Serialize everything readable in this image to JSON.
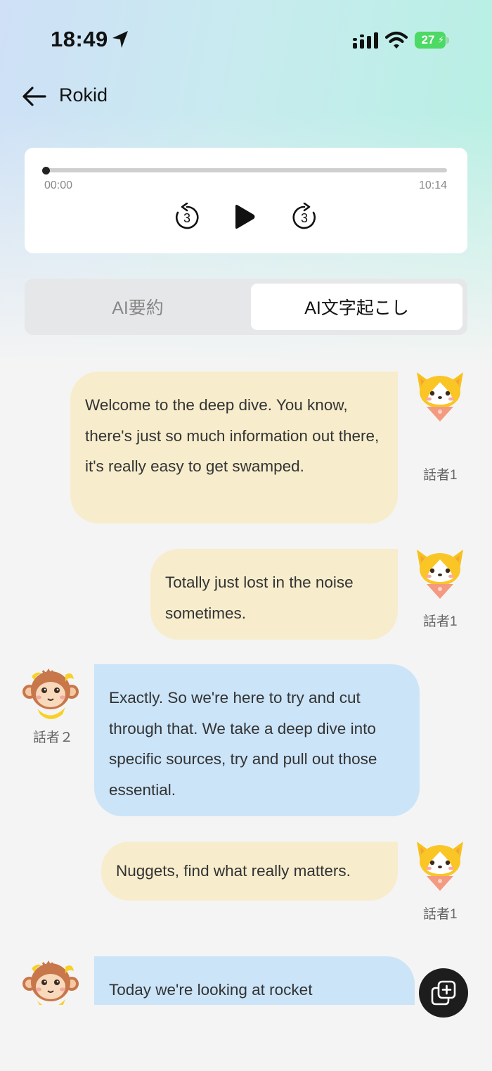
{
  "status_bar": {
    "time": "18:49",
    "battery": "27"
  },
  "header": {
    "title": "Rokid"
  },
  "player": {
    "current_time": "00:00",
    "total_time": "10:14",
    "skip_back_seconds": "3",
    "skip_forward_seconds": "3",
    "progress": 0
  },
  "tabs": {
    "summary": "AI要約",
    "transcript": "AI文字起こし",
    "active": "transcript"
  },
  "messages": [
    {
      "speaker": "話者1",
      "avatar": "corgi-avatar",
      "text": "Welcome to the deep dive. You know, there's just so much information out there, it's really easy to get swamped."
    },
    {
      "speaker": "話者1",
      "avatar": "corgi-avatar",
      "text": "Totally just lost in the noise sometimes."
    },
    {
      "speaker": "話者２",
      "avatar": "monkey-avatar",
      "text": "Exactly. So we're here to try and cut through that. We take a deep dive into specific sources, try and pull out those essential."
    },
    {
      "speaker": "話者1",
      "avatar": "corgi-avatar",
      "text": "Nuggets, find what really matters."
    },
    {
      "speaker": "",
      "avatar": "monkey-avatar",
      "text": "Today we're looking at rocket"
    }
  ],
  "colors": {
    "speaker1_bubble": "#f7edcd",
    "speaker2_bubble": "#cbe4f8",
    "accent": "#1d1d1d",
    "battery": "#4cd964"
  },
  "icons": [
    "location-arrow-icon",
    "signal-icon",
    "wifi-icon",
    "battery-icon",
    "back-arrow-icon",
    "rewind-3-icon",
    "play-icon",
    "forward-3-icon",
    "copy-plus-icon"
  ]
}
